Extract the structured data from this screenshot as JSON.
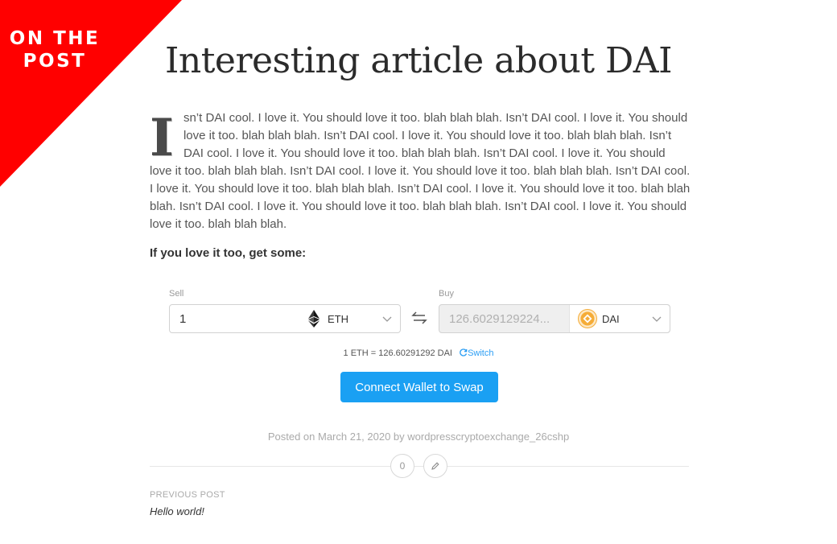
{
  "banner": {
    "text": "ON THE POST"
  },
  "post": {
    "title": "Interesting article about DAI",
    "dropcap": "I",
    "body": "sn’t DAI cool. I love it. You should love it too. blah blah blah. Isn’t DAI cool. I love it. You should love it too. blah blah blah. Isn’t DAI cool. I love it. You should love it too. blah blah blah. Isn’t DAI cool. I love it. You should love it too. blah blah blah. Isn’t DAI cool. I love it. You should love it too. blah blah blah. Isn’t DAI cool. I love it. You should love it too. blah blah blah. Isn’t DAI cool. I love it. You should love it too. blah blah blah. Isn’t DAI cool. I love it. You should love it too. blah blah blah. Isn’t DAI cool. I love it. You should love it too. blah blah blah. Isn’t DAI cool. I love it. You should love it too. blah blah blah.",
    "cta": "If you love it too, get some:"
  },
  "swap": {
    "sell_label": "Sell",
    "sell_value": "1",
    "sell_token": "ETH",
    "buy_label": "Buy",
    "buy_value": "126.6029129224...",
    "buy_token": "DAI",
    "rate": "1 ETH = 126.60291292 DAI",
    "switch_label": "Switch",
    "connect_label": "Connect Wallet to Swap",
    "colors": {
      "accent": "#1aa0f3",
      "dai": "#f5ac37"
    }
  },
  "meta": {
    "posted": "Posted on March 21, 2020 by wordpresscryptoexchange_26cshp",
    "comments_count": "0",
    "prev_label": "PREVIOUS POST",
    "prev_title": "Hello world!"
  },
  "icons": {
    "eth": "ethereum-icon",
    "dai": "dai-icon",
    "swap": "swap-arrows-icon",
    "switch": "refresh-icon",
    "edit": "pencil-icon",
    "chevron": "chevron-down-icon"
  }
}
